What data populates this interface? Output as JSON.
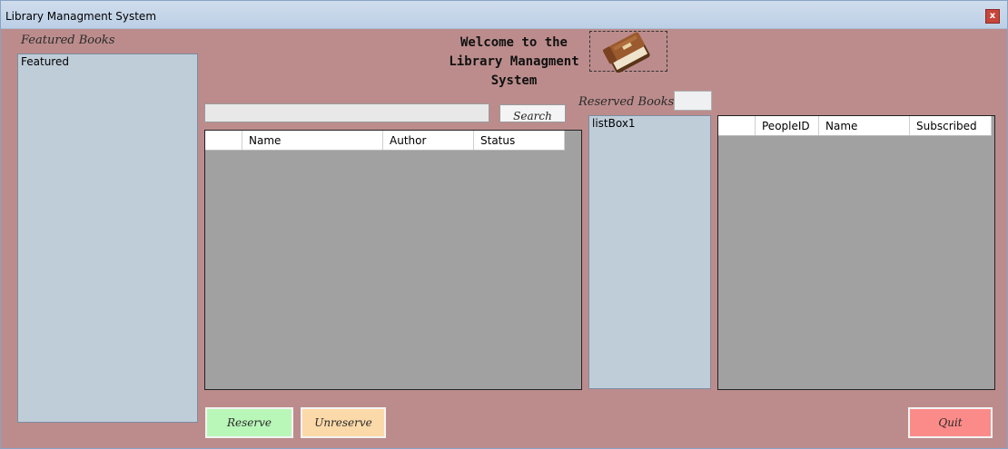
{
  "window": {
    "title": "Library Managment System",
    "close_label": "x"
  },
  "featured": {
    "label": "Featured Books",
    "items": [
      "Featured"
    ]
  },
  "welcome": {
    "lines": [
      "Welcome to the",
      "Library Managment",
      "System"
    ]
  },
  "search": {
    "value": "",
    "button_label": "Search"
  },
  "books_grid": {
    "columns": [
      "",
      "Name",
      "Author",
      "Status"
    ],
    "rows": []
  },
  "reserved": {
    "label": "Reserved Books",
    "count_value": "",
    "list_items": [
      "listBox1"
    ]
  },
  "people_grid": {
    "columns": [
      "",
      "PeopleID",
      "Name",
      "Subscribed"
    ],
    "rows": []
  },
  "buttons": {
    "reserve": "Reserve",
    "unreserve": "Unreserve",
    "quit": "Quit"
  },
  "colors": {
    "form_bg": "#bc8c8c",
    "reserve_btn": "#b9f7b9",
    "unreserve_btn": "#fcd9a9",
    "quit_btn": "#fb8b89",
    "list_bg": "#bfcdd9",
    "grid_bg": "#a1a1a1"
  },
  "icons": {
    "logo": "book-icon"
  }
}
